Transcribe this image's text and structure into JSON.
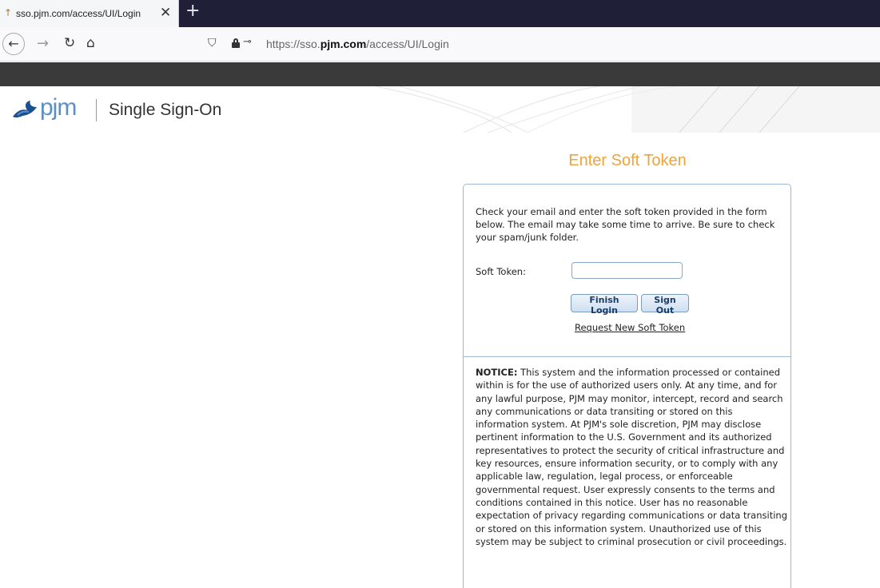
{
  "browser": {
    "tab_title": "sso.pjm.com/access/UI/Login",
    "tab_close": "✕",
    "new_tab": "+",
    "url_prefix": "https://sso.",
    "url_domain": "pjm.com",
    "url_path": "/access/UI/Login"
  },
  "nav": {
    "back_glyph": "←",
    "forward_glyph": "→",
    "reload_glyph": "↻",
    "home_glyph": "⌂"
  },
  "header": {
    "logo_text": "pjm",
    "title": "Single Sign-On",
    "stripe_colors": [
      "#c9c9c9",
      "#f2b12e",
      "#c9c9c9",
      "#46a3d6",
      "#c9c9c9",
      "#e0457b",
      "#8db33a",
      "#c9c9c9",
      "#46a3d6",
      "#f2b12e",
      "#c9c9c9",
      "#8c6bb1",
      "#46a3d6",
      "#c9c9c9",
      "#8db33a"
    ]
  },
  "main": {
    "title": "Enter Soft Token",
    "intro": "Check your email and enter the soft token provided in the form below. The email may take some time to arrive. Be sure to check your spam/junk folder.",
    "token_label": "Soft Token:",
    "token_value": "",
    "finish_label": "Finish Login",
    "signout_label": "Sign Out",
    "request_link": "Request New Soft Token",
    "notice_label": "NOTICE:",
    "notice_text": " This system and the information processed or contained within is for the use of authorized users only. At any time, and for any lawful purpose, PJM may monitor, intercept, record and search any communications or data transiting or stored on this information system. At PJM's sole discretion, PJM may disclose pertinent information to the U.S. Government and its authorized representatives to protect the security of critical infrastructure and key resources, ensure information security, or to comply with any applicable law, regulation, legal process, or enforceable governmental request. User expressly consents to the terms and conditions contained in this notice. User has no reasonable expectation of privacy regarding communications or data transiting or stored on this information system. Unauthorized use of this system may be subject to criminal prosecution or civil proceedings."
  },
  "colors": {
    "accent_orange": "#f0a33a",
    "panel_border": "#9bb8d6",
    "tab_strip": "#1f2038"
  }
}
